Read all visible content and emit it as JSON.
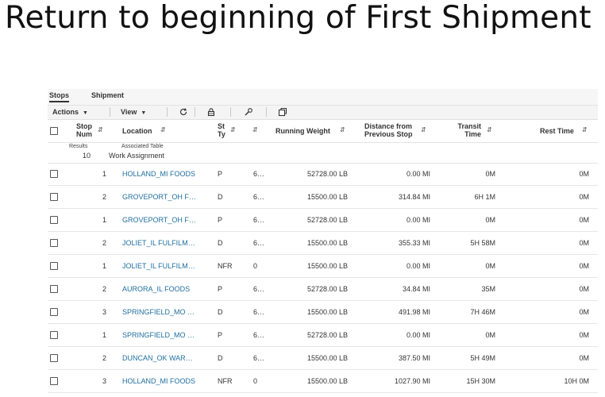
{
  "slide": {
    "title": "Return to beginning of First Shipment"
  },
  "tabs": [
    {
      "label": "Stops"
    },
    {
      "label": "Shipment"
    }
  ],
  "toolbar": {
    "actions_label": "Actions",
    "view_label": "View"
  },
  "table": {
    "headers": {
      "stop_num_1": "Stop",
      "stop_num_2": "Num",
      "location": "Location",
      "stop_type_1": "St",
      "stop_type_2": "Ty",
      "running_weight": "Running Weight",
      "distance_1": "Distance from",
      "distance_2": "Previous Stop",
      "transit_1": "Transit",
      "transit_2": "Time",
      "rest_time": "Rest Time"
    },
    "results_label": "Results",
    "results_count": "10",
    "associated_label": "Associated Table",
    "associated_value": "Work Assignment",
    "rows": [
      {
        "stop": "1",
        "location": "HOLLAND_MI FOODS",
        "type": "P",
        "col6": "6…",
        "weight": "52728.00 LB",
        "distance": "0.00 MI",
        "transit": "0M",
        "rest": "0M"
      },
      {
        "stop": "2",
        "location": "GROVEPORT_OH F…",
        "type": "D",
        "col6": "6…",
        "weight": "15500.00 LB",
        "distance": "314.84 MI",
        "transit": "6H 1M",
        "rest": "0M"
      },
      {
        "stop": "1",
        "location": "GROVEPORT_OH F…",
        "type": "P",
        "col6": "6…",
        "weight": "52728.00 LB",
        "distance": "0.00 MI",
        "transit": "0M",
        "rest": "0M"
      },
      {
        "stop": "2",
        "location": "JOLIET_IL FULFILM…",
        "type": "D",
        "col6": "6…",
        "weight": "15500.00 LB",
        "distance": "355.33 MI",
        "transit": "5H 58M",
        "rest": "0M"
      },
      {
        "stop": "1",
        "location": "JOLIET_IL FULFILM…",
        "type": "NFR",
        "col6": "0",
        "weight": "15500.00 LB",
        "distance": "0.00 MI",
        "transit": "0M",
        "rest": "0M"
      },
      {
        "stop": "2",
        "location": "AURORA_IL FOODS",
        "type": "P",
        "col6": "6…",
        "weight": "52728.00 LB",
        "distance": "34.84 MI",
        "transit": "35M",
        "rest": "0M"
      },
      {
        "stop": "3",
        "location": "SPRINGFIELD_MO …",
        "type": "D",
        "col6": "6…",
        "weight": "15500.00 LB",
        "distance": "491.98 MI",
        "transit": "7H 46M",
        "rest": "0M"
      },
      {
        "stop": "1",
        "location": "SPRINGFIELD_MO …",
        "type": "P",
        "col6": "6…",
        "weight": "52728.00 LB",
        "distance": "0.00 MI",
        "transit": "0M",
        "rest": "0M"
      },
      {
        "stop": "2",
        "location": "DUNCAN_OK WAR…",
        "type": "D",
        "col6": "6…",
        "weight": "15500.00 LB",
        "distance": "387.50 MI",
        "transit": "5H 49M",
        "rest": "0M"
      },
      {
        "stop": "3",
        "location": "HOLLAND_MI FOODS",
        "type": "NFR",
        "col6": "0",
        "weight": "15500.00 LB",
        "distance": "1027.90 MI",
        "transit": "15H 30M",
        "rest": "10H 0M"
      }
    ]
  },
  "icons": [
    "refresh-icon",
    "lock-icon",
    "wrench-icon",
    "detach-icon",
    "sort-icon",
    "checkbox-icon"
  ]
}
